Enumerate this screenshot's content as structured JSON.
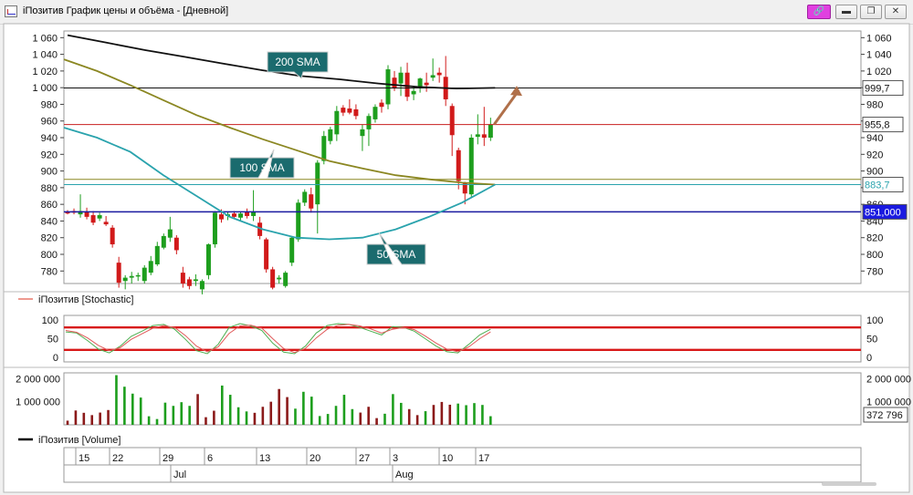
{
  "window": {
    "title": "iПозитив График цены и объёма - [Дневной]",
    "buttons": {
      "pin": "🔗",
      "minimize": "▬",
      "maximize": "❐",
      "close": "✕"
    }
  },
  "colors": {
    "up": "#1d9e1d",
    "down": "#d11a1a",
    "sma200": "#111111",
    "sma100": "#8b8722",
    "sma50": "#2aa3ad",
    "support": "#1a1aa0",
    "resistance": "#c81e1e",
    "stoch_band": "#d81818",
    "callout_bg": "#1b6b6e",
    "arrow": "#b0704a"
  },
  "chart_data": [
    {
      "type": "candlestick",
      "ylim": [
        765,
        1068
      ],
      "y_ticks": [
        "1 060",
        "1 040",
        "1 020",
        "1 000",
        "980",
        "960",
        "940",
        "920",
        "900",
        "880",
        "860",
        "840",
        "820",
        "800",
        "780"
      ],
      "x_tick_labels": [
        "15",
        "22",
        "29",
        "6",
        "13",
        "20",
        "27",
        "3",
        "10",
        "17"
      ],
      "month_labels": [
        "Jul",
        "Aug"
      ],
      "candles": [
        {
          "o": 851,
          "h": 853,
          "l": 848,
          "c": 849
        },
        {
          "o": 852,
          "h": 855,
          "l": 848,
          "c": 850
        },
        {
          "o": 848,
          "h": 872,
          "l": 844,
          "c": 852
        },
        {
          "o": 851,
          "h": 856,
          "l": 842,
          "c": 845
        },
        {
          "o": 847,
          "h": 852,
          "l": 835,
          "c": 838
        },
        {
          "o": 843,
          "h": 850,
          "l": 840,
          "c": 847
        },
        {
          "o": 839,
          "h": 846,
          "l": 834,
          "c": 836
        },
        {
          "o": 832,
          "h": 835,
          "l": 808,
          "c": 812
        },
        {
          "o": 790,
          "h": 797,
          "l": 760,
          "c": 766
        },
        {
          "o": 768,
          "h": 775,
          "l": 758,
          "c": 772
        },
        {
          "o": 772,
          "h": 779,
          "l": 765,
          "c": 774
        },
        {
          "o": 774,
          "h": 778,
          "l": 768,
          "c": 775
        },
        {
          "o": 768,
          "h": 787,
          "l": 765,
          "c": 784
        },
        {
          "o": 778,
          "h": 798,
          "l": 775,
          "c": 792
        },
        {
          "o": 788,
          "h": 815,
          "l": 786,
          "c": 810
        },
        {
          "o": 808,
          "h": 825,
          "l": 806,
          "c": 822
        },
        {
          "o": 820,
          "h": 845,
          "l": 815,
          "c": 830
        },
        {
          "o": 820,
          "h": 823,
          "l": 800,
          "c": 805
        },
        {
          "o": 778,
          "h": 785,
          "l": 760,
          "c": 765
        },
        {
          "o": 770,
          "h": 773,
          "l": 758,
          "c": 762
        },
        {
          "o": 768,
          "h": 776,
          "l": 762,
          "c": 770
        },
        {
          "o": 758,
          "h": 770,
          "l": 752,
          "c": 768
        },
        {
          "o": 775,
          "h": 813,
          "l": 770,
          "c": 812
        },
        {
          "o": 812,
          "h": 852,
          "l": 808,
          "c": 850
        },
        {
          "o": 848,
          "h": 854,
          "l": 838,
          "c": 842
        },
        {
          "o": 846,
          "h": 851,
          "l": 841,
          "c": 848
        },
        {
          "o": 849,
          "h": 852,
          "l": 843,
          "c": 845
        },
        {
          "o": 844,
          "h": 851,
          "l": 841,
          "c": 849
        },
        {
          "o": 851,
          "h": 855,
          "l": 843,
          "c": 846
        },
        {
          "o": 846,
          "h": 877,
          "l": 840,
          "c": 851
        },
        {
          "o": 838,
          "h": 845,
          "l": 818,
          "c": 822
        },
        {
          "o": 818,
          "h": 820,
          "l": 778,
          "c": 782
        },
        {
          "o": 782,
          "h": 785,
          "l": 758,
          "c": 760
        },
        {
          "o": 770,
          "h": 775,
          "l": 765,
          "c": 772
        },
        {
          "o": 762,
          "h": 780,
          "l": 760,
          "c": 778
        },
        {
          "o": 790,
          "h": 822,
          "l": 786,
          "c": 820
        },
        {
          "o": 818,
          "h": 866,
          "l": 815,
          "c": 862
        },
        {
          "o": 862,
          "h": 878,
          "l": 858,
          "c": 875
        },
        {
          "o": 872,
          "h": 880,
          "l": 850,
          "c": 855
        },
        {
          "o": 860,
          "h": 913,
          "l": 825,
          "c": 910
        },
        {
          "o": 912,
          "h": 948,
          "l": 908,
          "c": 942
        },
        {
          "o": 936,
          "h": 953,
          "l": 932,
          "c": 950
        },
        {
          "o": 944,
          "h": 978,
          "l": 936,
          "c": 972
        },
        {
          "o": 976,
          "h": 979,
          "l": 966,
          "c": 970
        },
        {
          "o": 975,
          "h": 986,
          "l": 968,
          "c": 970
        },
        {
          "o": 974,
          "h": 980,
          "l": 962,
          "c": 966
        },
        {
          "o": 942,
          "h": 956,
          "l": 924,
          "c": 950
        },
        {
          "o": 950,
          "h": 969,
          "l": 930,
          "c": 966
        },
        {
          "o": 962,
          "h": 980,
          "l": 958,
          "c": 977
        },
        {
          "o": 982,
          "h": 986,
          "l": 970,
          "c": 977
        },
        {
          "o": 980,
          "h": 1027,
          "l": 974,
          "c": 1022
        },
        {
          "o": 1012,
          "h": 1020,
          "l": 996,
          "c": 999
        },
        {
          "o": 1005,
          "h": 1025,
          "l": 990,
          "c": 1018
        },
        {
          "o": 1018,
          "h": 1030,
          "l": 984,
          "c": 989
        },
        {
          "o": 992,
          "h": 1002,
          "l": 985,
          "c": 996
        },
        {
          "o": 1001,
          "h": 1012,
          "l": 994,
          "c": 1011
        },
        {
          "o": 1006,
          "h": 1018,
          "l": 995,
          "c": 1003
        },
        {
          "o": 1012,
          "h": 1035,
          "l": 1008,
          "c": 1015
        },
        {
          "o": 1018,
          "h": 1024,
          "l": 1006,
          "c": 1015
        },
        {
          "o": 1013,
          "h": 1038,
          "l": 978,
          "c": 986
        },
        {
          "o": 978,
          "h": 981,
          "l": 918,
          "c": 943
        },
        {
          "o": 925,
          "h": 928,
          "l": 878,
          "c": 888
        },
        {
          "o": 885,
          "h": 887,
          "l": 860,
          "c": 873
        },
        {
          "o": 872,
          "h": 944,
          "l": 869,
          "c": 940
        },
        {
          "o": 941,
          "h": 968,
          "l": 932,
          "c": 944
        },
        {
          "o": 944,
          "h": 977,
          "l": 930,
          "c": 940
        },
        {
          "o": 940,
          "h": 964,
          "l": 936,
          "c": 956
        }
      ],
      "sma": [
        {
          "name": "200 SMA",
          "values": [
            1063,
            1054,
            1045,
            1037,
            1029,
            1021,
            1014,
            1010,
            1005,
            1001,
            999,
            999.7
          ]
        },
        {
          "name": "100 SMA",
          "values": [
            1034,
            1020,
            1003,
            985,
            967,
            952,
            938,
            925,
            912,
            903,
            895,
            890,
            886,
            883.7
          ]
        },
        {
          "name": "50 SMA",
          "values": [
            952,
            940,
            923,
            895,
            870,
            845,
            830,
            820,
            818,
            820,
            830,
            845,
            862,
            883.7
          ]
        }
      ],
      "levels": [
        {
          "value": 999.7,
          "label": "999,7",
          "role": "200 SMA"
        },
        {
          "value": 955.8,
          "label": "955,8",
          "role": "resistance"
        },
        {
          "value": 883.7,
          "label": "883,7",
          "role": "50/100 SMA"
        },
        {
          "value": 851.0,
          "label": "851,000",
          "role": "support"
        },
        {
          "value": 890,
          "label": "",
          "role": "100 SMA"
        }
      ],
      "annotations": [
        "200 SMA",
        "100 SMA",
        "50 SMA"
      ],
      "forecast_arrow": {
        "from": 956,
        "to": 1000
      }
    },
    {
      "type": "line",
      "title": "iПозитив [Stochastic]",
      "ylim": [
        -12,
        112
      ],
      "y_ticks": [
        "100",
        "50",
        "0"
      ],
      "bands": [
        80,
        20
      ],
      "series": [
        {
          "name": "%K",
          "values": [
            68,
            65,
            45,
            22,
            12,
            30,
            56,
            70,
            85,
            88,
            75,
            48,
            18,
            10,
            35,
            80,
            90,
            84,
            72,
            38,
            14,
            10,
            30,
            65,
            85,
            90,
            88,
            80,
            70,
            60,
            82,
            80,
            70,
            50,
            30,
            15,
            12,
            35,
            60,
            75
          ]
        },
        {
          "name": "%D",
          "values": [
            72,
            67,
            52,
            32,
            18,
            26,
            48,
            63,
            78,
            85,
            80,
            58,
            30,
            15,
            28,
            64,
            84,
            86,
            78,
            50,
            24,
            13,
            24,
            52,
            75,
            86,
            88,
            84,
            76,
            65,
            75,
            80,
            74,
            57,
            38,
            22,
            15,
            28,
            50,
            68
          ]
        }
      ]
    },
    {
      "type": "bar",
      "title": "iПозитив [Volume]",
      "ylim": [
        0,
        2250000
      ],
      "y_ticks": [
        "2 000 000",
        "1 000 000"
      ],
      "last_value_label": "372 796",
      "values": [
        {
          "v": 180000,
          "d": "down"
        },
        {
          "v": 620000,
          "d": "down"
        },
        {
          "v": 520000,
          "d": "down"
        },
        {
          "v": 420000,
          "d": "down"
        },
        {
          "v": 530000,
          "d": "down"
        },
        {
          "v": 640000,
          "d": "down"
        },
        {
          "v": 2150000,
          "d": "up"
        },
        {
          "v": 1650000,
          "d": "up"
        },
        {
          "v": 1350000,
          "d": "up"
        },
        {
          "v": 1180000,
          "d": "up"
        },
        {
          "v": 370000,
          "d": "up"
        },
        {
          "v": 250000,
          "d": "up"
        },
        {
          "v": 960000,
          "d": "up"
        },
        {
          "v": 820000,
          "d": "up"
        },
        {
          "v": 980000,
          "d": "up"
        },
        {
          "v": 820000,
          "d": "up"
        },
        {
          "v": 1330000,
          "d": "down"
        },
        {
          "v": 330000,
          "d": "down"
        },
        {
          "v": 610000,
          "d": "down"
        },
        {
          "v": 1700000,
          "d": "up"
        },
        {
          "v": 1300000,
          "d": "up"
        },
        {
          "v": 760000,
          "d": "up"
        },
        {
          "v": 580000,
          "d": "up"
        },
        {
          "v": 520000,
          "d": "down"
        },
        {
          "v": 780000,
          "d": "down"
        },
        {
          "v": 1000000,
          "d": "down"
        },
        {
          "v": 1550000,
          "d": "down"
        },
        {
          "v": 1200000,
          "d": "down"
        },
        {
          "v": 700000,
          "d": "up"
        },
        {
          "v": 1430000,
          "d": "up"
        },
        {
          "v": 1220000,
          "d": "up"
        },
        {
          "v": 380000,
          "d": "up"
        },
        {
          "v": 470000,
          "d": "up"
        },
        {
          "v": 820000,
          "d": "up"
        },
        {
          "v": 1300000,
          "d": "up"
        },
        {
          "v": 680000,
          "d": "up"
        },
        {
          "v": 530000,
          "d": "down"
        },
        {
          "v": 780000,
          "d": "down"
        },
        {
          "v": 290000,
          "d": "down"
        },
        {
          "v": 480000,
          "d": "up"
        },
        {
          "v": 1330000,
          "d": "up"
        },
        {
          "v": 950000,
          "d": "up"
        },
        {
          "v": 680000,
          "d": "down"
        },
        {
          "v": 420000,
          "d": "down"
        },
        {
          "v": 590000,
          "d": "up"
        },
        {
          "v": 860000,
          "d": "down"
        },
        {
          "v": 990000,
          "d": "down"
        },
        {
          "v": 870000,
          "d": "down"
        },
        {
          "v": 920000,
          "d": "up"
        },
        {
          "v": 850000,
          "d": "up"
        },
        {
          "v": 940000,
          "d": "up"
        },
        {
          "v": 860000,
          "d": "up"
        },
        {
          "v": 372796,
          "d": "up"
        }
      ]
    }
  ]
}
